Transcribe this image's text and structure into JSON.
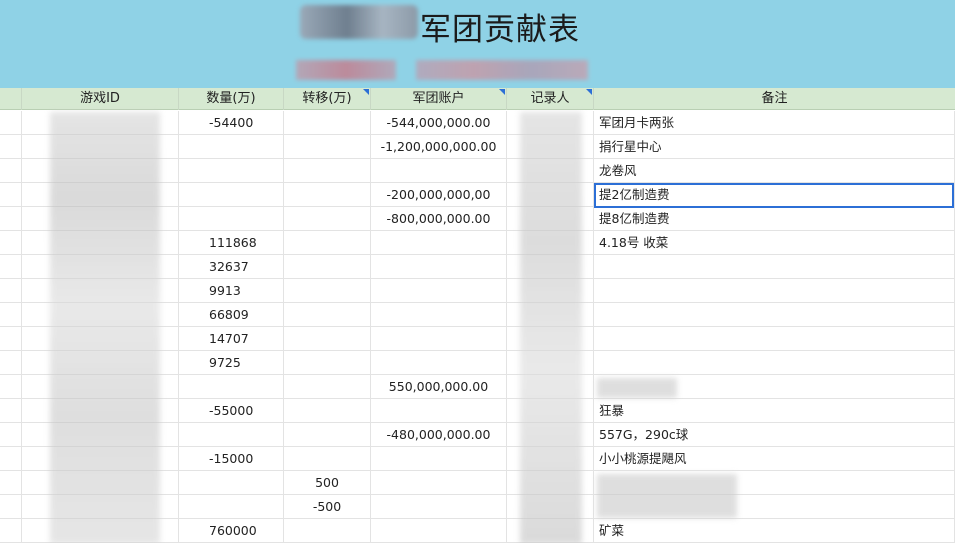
{
  "title": "军团贡献表",
  "columns": {
    "game_id": "游戏ID",
    "quantity": "数量(万)",
    "transfer": "转移(万)",
    "account": "军团账户",
    "recorder": "记录人",
    "note": "备注"
  },
  "rows": [
    {
      "quantity": "-54400",
      "transfer": "",
      "account": "-544,000,000.00",
      "note": "军团月卡两张"
    },
    {
      "quantity": "",
      "transfer": "",
      "account": "-1,200,000,000.00",
      "note": "捐行星中心"
    },
    {
      "quantity": "",
      "transfer": "",
      "account": "",
      "note": "龙卷风"
    },
    {
      "quantity": "",
      "transfer": "",
      "account": "-200,000,000,00",
      "note": "提2亿制造费"
    },
    {
      "quantity": "",
      "transfer": "",
      "account": "-800,000,000.00",
      "note": "提8亿制造费"
    },
    {
      "quantity": "111868",
      "transfer": "",
      "account": "",
      "note": "4.18号 收菜"
    },
    {
      "quantity": "32637",
      "transfer": "",
      "account": "",
      "note": ""
    },
    {
      "quantity": "9913",
      "transfer": "",
      "account": "",
      "note": ""
    },
    {
      "quantity": "66809",
      "transfer": "",
      "account": "",
      "note": ""
    },
    {
      "quantity": "14707",
      "transfer": "",
      "account": "",
      "note": ""
    },
    {
      "quantity": "9725",
      "transfer": "",
      "account": "",
      "note": ""
    },
    {
      "quantity": "",
      "transfer": "",
      "account": "550,000,000.00",
      "note": ""
    },
    {
      "quantity": "-55000",
      "transfer": "",
      "account": "",
      "note": "狂暴"
    },
    {
      "quantity": "",
      "transfer": "",
      "account": "-480,000,000.00",
      "note": "557G，290c球"
    },
    {
      "quantity": "-15000",
      "transfer": "",
      "account": "",
      "note": "小小桃源提飓风"
    },
    {
      "quantity": "",
      "transfer": "500",
      "account": "",
      "note": ""
    },
    {
      "quantity": "",
      "transfer": "-500",
      "account": "",
      "note": ""
    },
    {
      "quantity": "760000",
      "transfer": "",
      "account": "",
      "note": "矿菜"
    }
  ],
  "colors": {
    "banner": "#8fd2e6",
    "header": "#d6e9d1",
    "selection": "#2c6fd6"
  }
}
